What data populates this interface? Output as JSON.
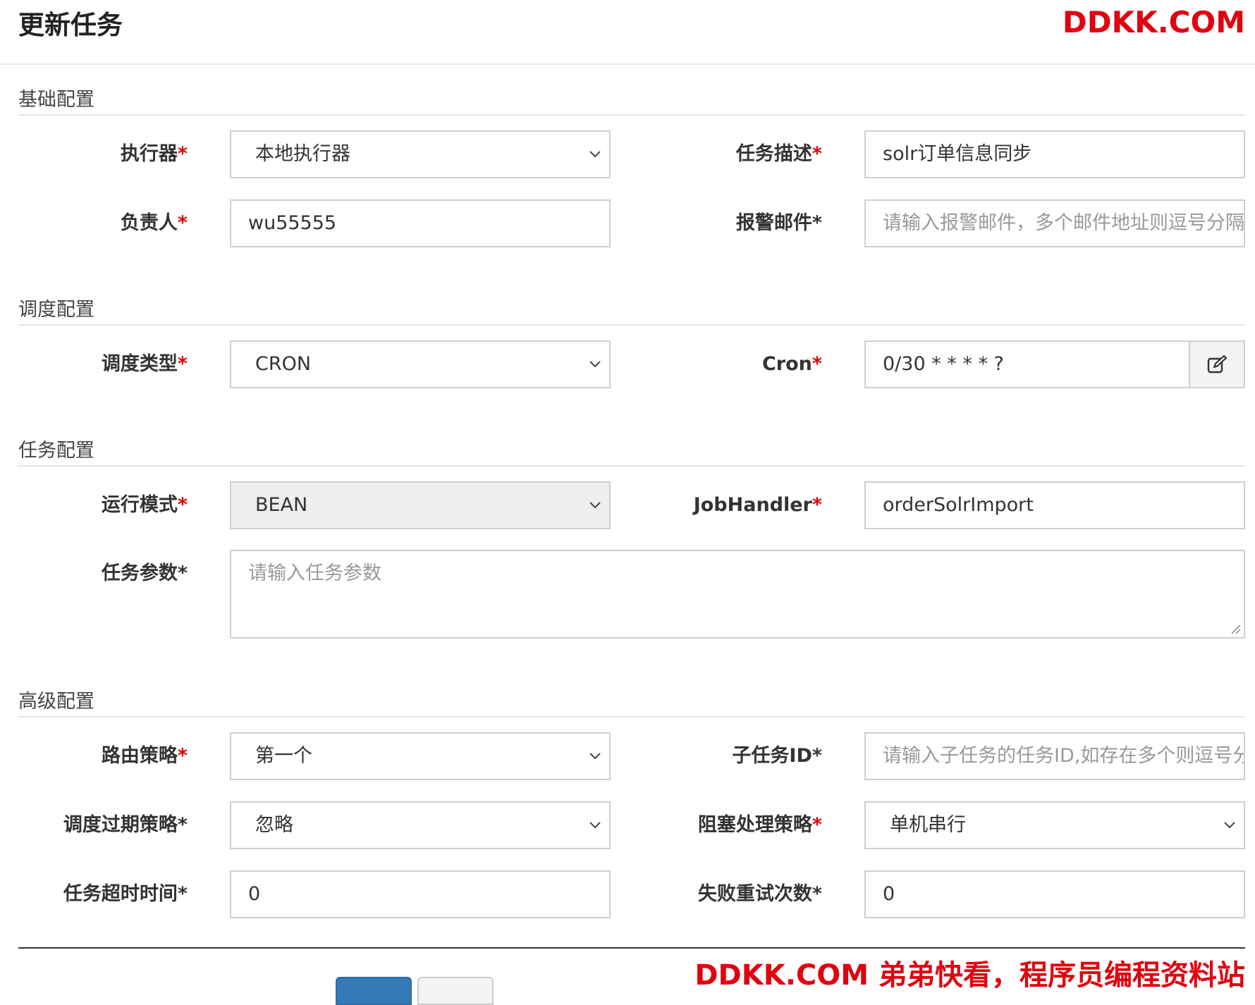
{
  "modal": {
    "title": "更新任务"
  },
  "watermark": {
    "top": "DDKK.COM",
    "bottom": "DDKK.COM 弟弟快看，程序员编程资料站"
  },
  "sections": {
    "basic": "基础配置",
    "schedule": "调度配置",
    "task": "任务配置",
    "advanced": "高级配置"
  },
  "fields": {
    "executor": {
      "label": "执行器",
      "required_mark": "*",
      "value": "本地执行器"
    },
    "job_desc": {
      "label": "任务描述",
      "required_mark": "*",
      "value": "solr订单信息同步"
    },
    "owner": {
      "label": "负责人",
      "required_mark": "*",
      "value": "wu55555"
    },
    "alarm_email": {
      "label": "报警邮件*",
      "placeholder": "请输入报警邮件，多个邮件地址则逗号分隔"
    },
    "schedule_type": {
      "label": "调度类型",
      "required_mark": "*",
      "value": "CRON"
    },
    "cron": {
      "label": "Cron",
      "required_mark": "*",
      "value": "0/30 * * * * ?",
      "edit_icon": "pencil-square-icon"
    },
    "glue_type": {
      "label": "运行模式",
      "required_mark": "*",
      "value": "BEAN"
    },
    "job_handler": {
      "label": "JobHandler",
      "required_mark": "*",
      "value": "orderSolrImport"
    },
    "job_param": {
      "label": "任务参数*",
      "placeholder": "请输入任务参数"
    },
    "route_strategy": {
      "label": "路由策略",
      "required_mark": "*",
      "value": "第一个"
    },
    "child_job_id": {
      "label": "子任务ID*",
      "placeholder": "请输入子任务的任务ID,如存在多个则逗号分隔"
    },
    "misfire_strategy": {
      "label": "调度过期策略*",
      "value": "忽略"
    },
    "block_strategy": {
      "label": "阻塞处理策略",
      "required_mark": "*",
      "value": "单机串行"
    },
    "timeout": {
      "label": "任务超时时间*",
      "value": "0"
    },
    "fail_retry": {
      "label": "失败重试次数*",
      "value": "0"
    }
  },
  "colors": {
    "required": "#e00000",
    "primary": "#337ab7",
    "watermark": "#e1000f"
  }
}
